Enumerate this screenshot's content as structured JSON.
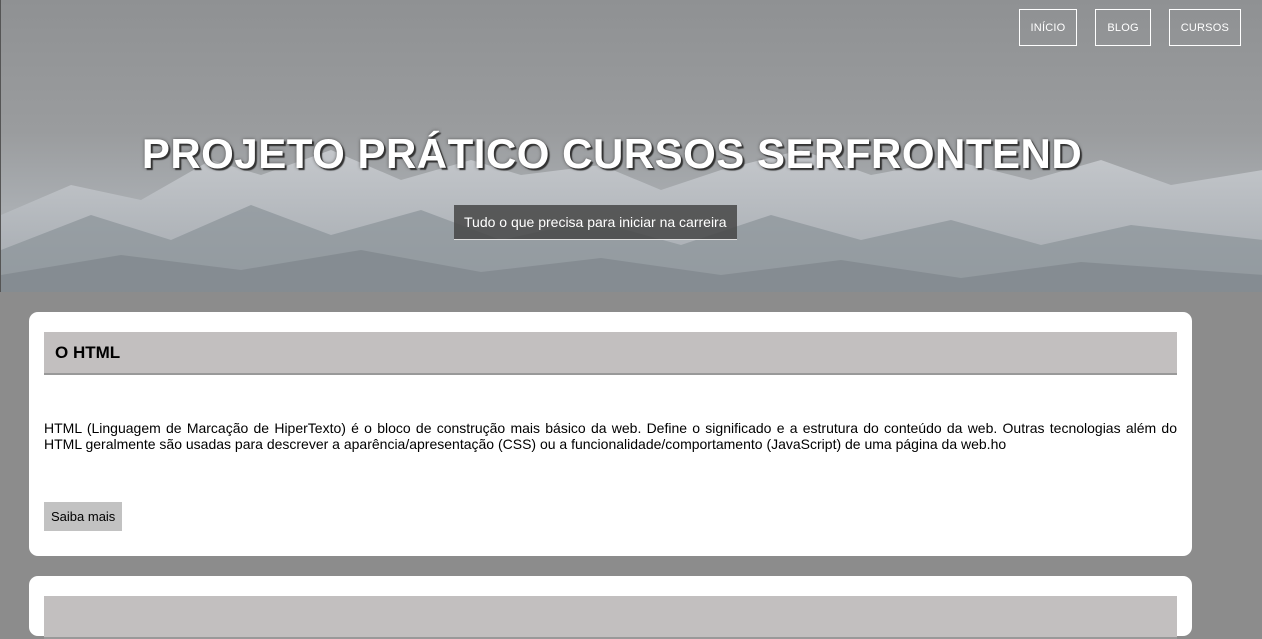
{
  "nav": {
    "items": [
      {
        "label": "INÍCIO"
      },
      {
        "label": "BLOG"
      },
      {
        "label": "CURSOS"
      }
    ]
  },
  "hero": {
    "title": "PROJETO PRÁTICO CURSOS SERFRONTEND",
    "subtitle": "Tudo o que precisa para iniciar na carreira"
  },
  "cards": [
    {
      "title": "O HTML",
      "text": "HTML (Linguagem de Marcação de HiperTexto) é o bloco de construção mais básico da web. Define o significado e a estrutura do conteúdo da web. Outras tecnologias além do HTML geralmente são usadas para descrever a aparência/apresentação (CSS) ou a funcionalidade/comportamento (JavaScript) de uma página da web.ho",
      "button_label": "Saiba mais"
    }
  ],
  "colors": {
    "page_background": "#8c8c8c",
    "card_background": "#ffffff",
    "card_header_background": "#c2bfbf",
    "button_background": "#c2c2c2"
  }
}
